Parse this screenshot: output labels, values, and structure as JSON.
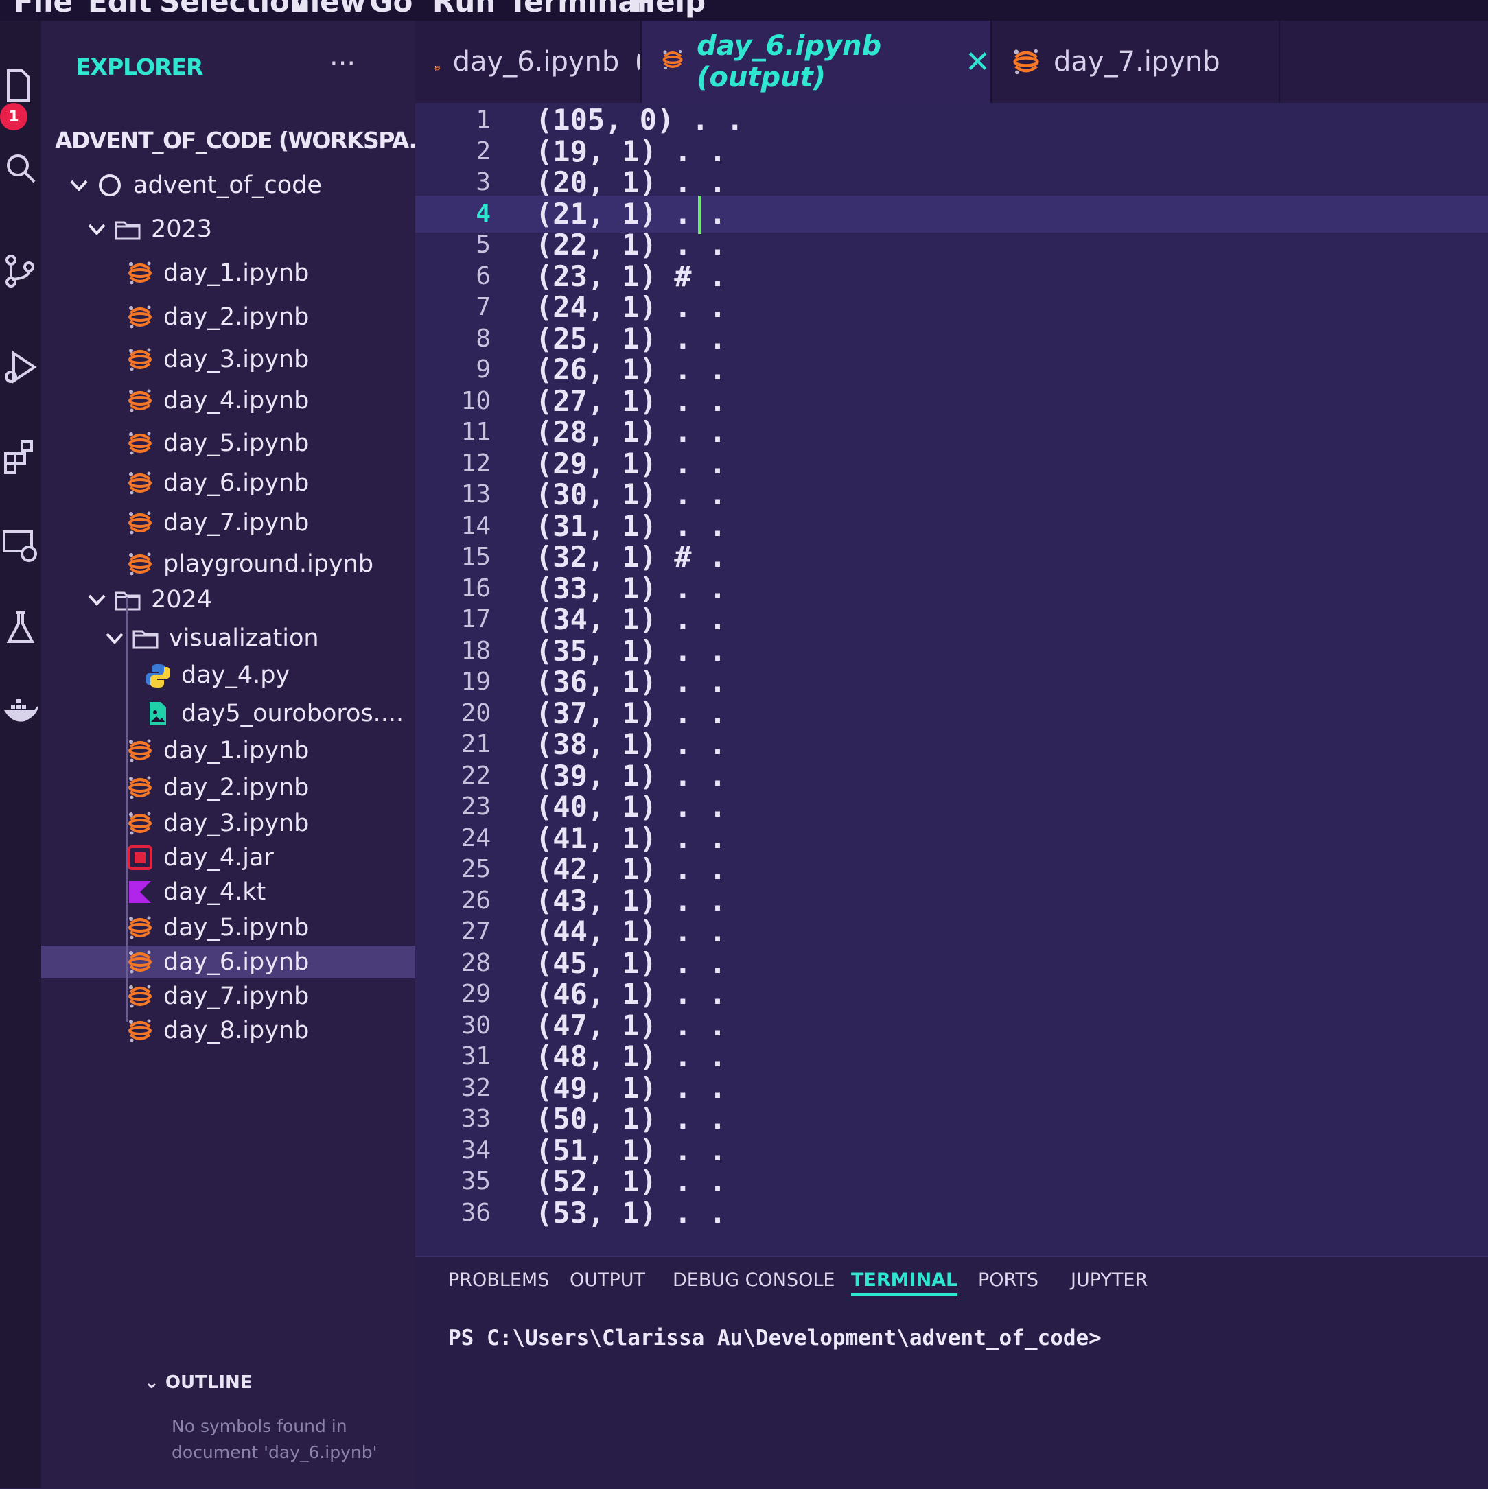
{
  "menu": [
    "File",
    "Edit",
    "Selection",
    "View",
    "Go",
    "Run",
    "Terminal",
    "Help"
  ],
  "activity_bar": {
    "badge": "1",
    "icons": [
      "files-icon",
      "search-icon",
      "source-control-icon",
      "run-debug-icon",
      "extensions-icon",
      "remote-explorer-icon",
      "testing-icon",
      "docker-icon"
    ]
  },
  "explorer": {
    "title": "EXPLORER",
    "more": "···",
    "tree": [
      {
        "label": "ADVENT_OF_CODE (WORKSPA...",
        "kind": "root",
        "depth": 0,
        "expanded": true
      },
      {
        "label": "advent_of_code",
        "kind": "repo",
        "depth": 1,
        "expanded": true
      },
      {
        "label": "2023",
        "kind": "folder",
        "depth": 2,
        "expanded": true
      },
      {
        "label": "day_1.ipynb",
        "kind": "jupyter",
        "depth": 3
      },
      {
        "label": "day_2.ipynb",
        "kind": "jupyter",
        "depth": 3
      },
      {
        "label": "day_3.ipynb",
        "kind": "jupyter",
        "depth": 3
      },
      {
        "label": "day_4.ipynb",
        "kind": "jupyter",
        "depth": 3
      },
      {
        "label": "day_5.ipynb",
        "kind": "jupyter",
        "depth": 3
      },
      {
        "label": "day_6.ipynb",
        "kind": "jupyter",
        "depth": 3
      },
      {
        "label": "day_7.ipynb",
        "kind": "jupyter",
        "depth": 3
      },
      {
        "label": "playground.ipynb",
        "kind": "jupyter",
        "depth": 3
      },
      {
        "label": "2024",
        "kind": "folder",
        "depth": 2,
        "expanded": true
      },
      {
        "label": "visualization",
        "kind": "folder",
        "depth": 3,
        "expanded": true
      },
      {
        "label": "day_4.py",
        "kind": "python",
        "depth": 4
      },
      {
        "label": "day5_ouroboros....",
        "kind": "image",
        "depth": 4
      },
      {
        "label": "day_1.ipynb",
        "kind": "jupyter",
        "depth": 3
      },
      {
        "label": "day_2.ipynb",
        "kind": "jupyter",
        "depth": 3
      },
      {
        "label": "day_3.ipynb",
        "kind": "jupyter",
        "depth": 3
      },
      {
        "label": "day_4.jar",
        "kind": "jar",
        "depth": 3
      },
      {
        "label": "day_4.kt",
        "kind": "kotlin",
        "depth": 3
      },
      {
        "label": "day_5.ipynb",
        "kind": "jupyter",
        "depth": 3
      },
      {
        "label": "day_6.ipynb",
        "kind": "jupyter",
        "depth": 3,
        "selected": true
      },
      {
        "label": "day_7.ipynb",
        "kind": "jupyter",
        "depth": 3
      },
      {
        "label": "day_8.ipynb",
        "kind": "jupyter",
        "depth": 3
      }
    ]
  },
  "outline": {
    "title": "OUTLINE",
    "message": "No symbols found in document 'day_6.ipynb'"
  },
  "tabs": [
    {
      "label": "day_6.ipynb",
      "dirty": true,
      "active": false
    },
    {
      "label": "day_6.ipynb (output)",
      "dirty": false,
      "active": true,
      "close": "✕"
    },
    {
      "label": "day_7.ipynb",
      "dirty": false,
      "active": false
    }
  ],
  "editor": {
    "current_line": 4,
    "lines": [
      "(105, 0) . .",
      "(19, 1) . .",
      "(20, 1) . .",
      "(21, 1) . .",
      "(22, 1) . .",
      "(23, 1) # .",
      "(24, 1) . .",
      "(25, 1) . .",
      "(26, 1) . .",
      "(27, 1) . .",
      "(28, 1) . .",
      "(29, 1) . .",
      "(30, 1) . .",
      "(31, 1) . .",
      "(32, 1) # .",
      "(33, 1) . .",
      "(34, 1) . .",
      "(35, 1) . .",
      "(36, 1) . .",
      "(37, 1) . .",
      "(38, 1) . .",
      "(39, 1) . .",
      "(40, 1) . .",
      "(41, 1) . .",
      "(42, 1) . .",
      "(43, 1) . .",
      "(44, 1) . .",
      "(45, 1) . .",
      "(46, 1) . .",
      "(47, 1) . .",
      "(48, 1) . .",
      "(49, 1) . .",
      "(50, 1) . .",
      "(51, 1) . .",
      "(52, 1) . .",
      "(53, 1) . ."
    ]
  },
  "panel": {
    "tabs": [
      "PROBLEMS",
      "OUTPUT",
      "DEBUG CONSOLE",
      "TERMINAL",
      "PORTS",
      "JUPYTER"
    ],
    "active_tab": "TERMINAL",
    "terminal_prompt": "PS C:\\Users\\Clarissa Au\\Development\\advent_of_code>"
  },
  "colors": {
    "accent": "#2fe6d0",
    "jupyter": "#f37726",
    "badge": "#e8204a",
    "jar": "#e2223f",
    "kotlin": "#b125ea",
    "image": "#1fd0a8",
    "caret": "#6ee86a"
  }
}
